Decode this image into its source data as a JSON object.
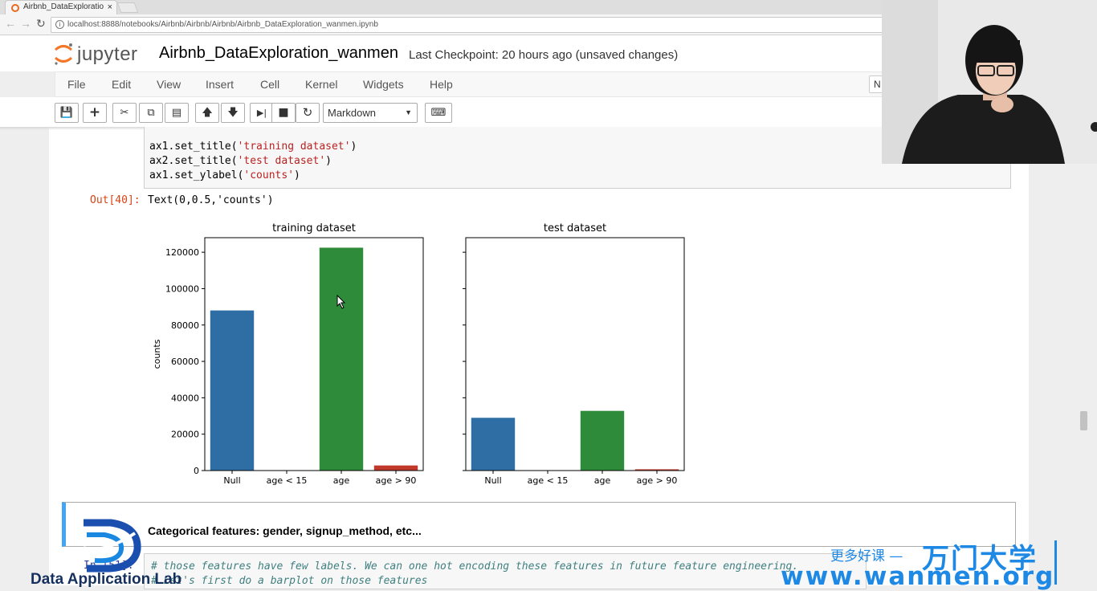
{
  "browser": {
    "tab_title": "Airbnb_DataExploratio",
    "tab_close": "×",
    "url": "localhost:8888/notebooks/Airbnb/Airbnb/Airbnb/Airbnb_DataExploration_wanmen.ipynb"
  },
  "jupyter": {
    "logo_text": "jupyter",
    "notebook_title": "Airbnb_DataExploration_wanmen",
    "checkpoint": "Last Checkpoint: 20 hours ago (unsaved changes)",
    "kernel_indicator": "N",
    "menu": [
      "File",
      "Edit",
      "View",
      "Insert",
      "Cell",
      "Kernel",
      "Widgets",
      "Help"
    ],
    "cell_type": "Markdown",
    "toolbar_icons": [
      "save-icon",
      "add-cell-icon",
      "cut-icon",
      "copy-icon",
      "paste-icon",
      "move-up-icon",
      "move-down-icon",
      "run-icon",
      "stop-icon",
      "restart-icon",
      "keyboard-icon"
    ]
  },
  "cells": {
    "code1": {
      "line1_prefix": "ax1.set_title(",
      "line1_str": "'training dataset'",
      "line1_suffix": ")",
      "line2_prefix": "ax2.set_title(",
      "line2_str": "'test dataset'",
      "line2_suffix": ")",
      "line3_prefix": "ax1.set_ylabel(",
      "line3_str": "'counts'",
      "line3_suffix": ")"
    },
    "out_prompt": "Out[40]:",
    "out_text": "Text(0,0.5,'counts')",
    "markdown_heading": "Categorical features: gender, signup_method, etc...",
    "in_prompt": "In [51]:",
    "code2_line1": "# those features have few labels. We can one hot encoding these features in future feature engineering.",
    "code2_line2": "# Let's first do a barplot on those features"
  },
  "chart_data": [
    {
      "type": "bar",
      "title": "training dataset",
      "ylabel": "counts",
      "xlabel": "",
      "categories": [
        "Null",
        "age < 15",
        "age",
        "age > 90"
      ],
      "values": [
        88000,
        200,
        122500,
        2800
      ],
      "colors": [
        "#2f6ea5",
        "#2f6ea5",
        "#2e8b3a",
        "#c0392b"
      ],
      "ylim": [
        0,
        128000
      ],
      "yticks": [
        0,
        20000,
        40000,
        60000,
        80000,
        100000,
        120000
      ],
      "grid": false
    },
    {
      "type": "bar",
      "title": "test dataset",
      "xlabel": "",
      "categories": [
        "Null",
        "age < 15",
        "age",
        "age > 90"
      ],
      "values": [
        29000,
        100,
        32800,
        700
      ],
      "colors": [
        "#2f6ea5",
        "#2f6ea5",
        "#2e8b3a",
        "#c0392b"
      ],
      "ylim": [
        0,
        128000
      ],
      "yticks": [
        0,
        20000,
        40000,
        60000,
        80000,
        100000,
        120000
      ],
      "show_ytick_labels": false,
      "grid": false
    }
  ],
  "watermark": {
    "org_name": "Data Application Lab",
    "more_courses": "更多好课 —",
    "brand": "万门大学",
    "site": "www.wanmen.org"
  }
}
